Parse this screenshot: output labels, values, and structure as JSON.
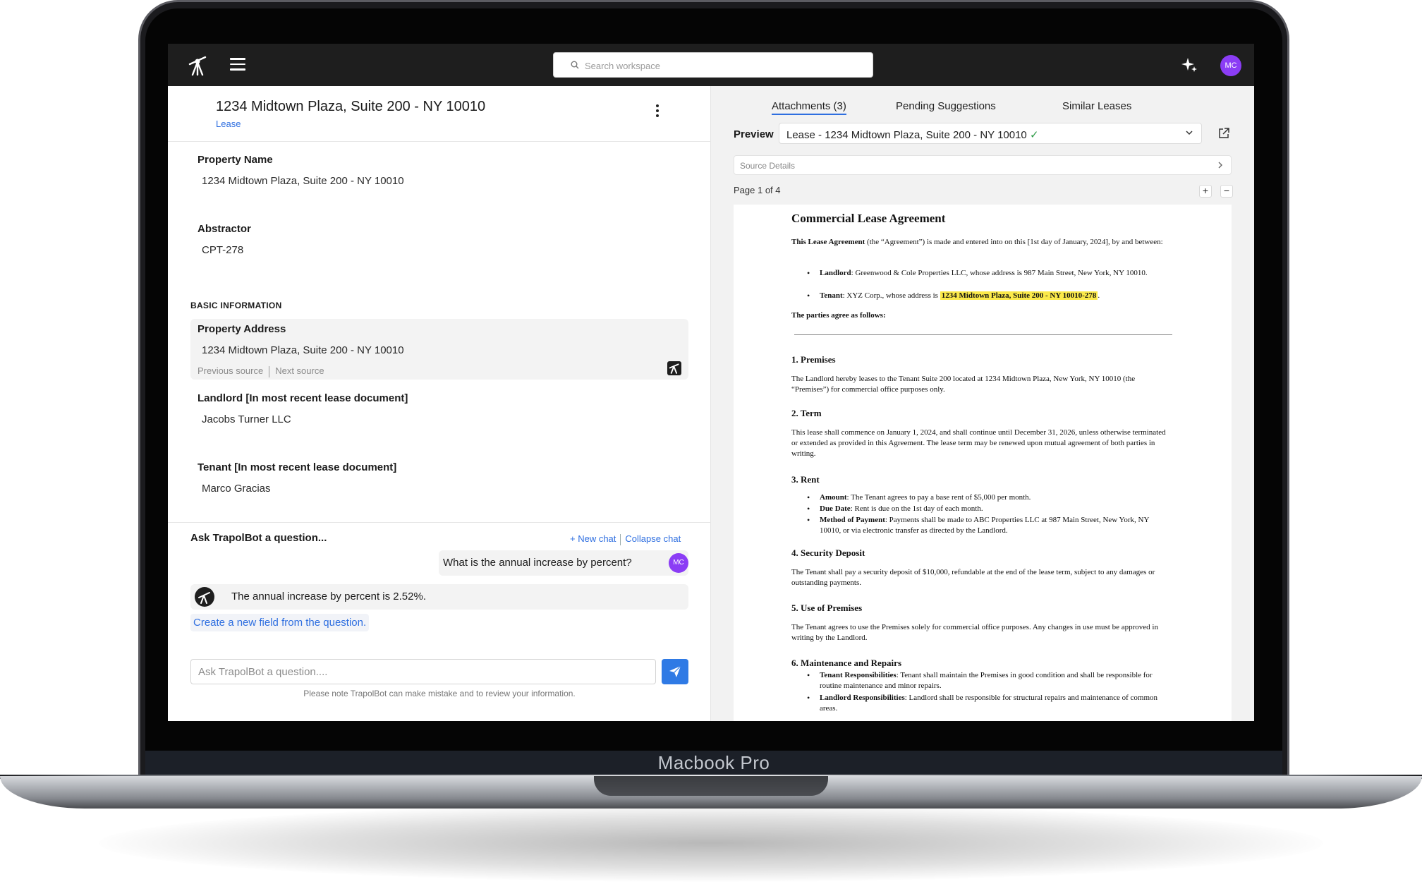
{
  "device": {
    "label": "Macbook Pro"
  },
  "topbar": {
    "search_placeholder": "Search workspace",
    "avatar_initials": "MC"
  },
  "record": {
    "title": "1234 Midtown Plaza, Suite 200 - NY 10010",
    "type": "Lease"
  },
  "fields": {
    "property_name": {
      "label": "Property Name",
      "value": "1234 Midtown Plaza, Suite 200 - NY 10010"
    },
    "abstractor": {
      "label": "Abstractor",
      "value": "CPT-278"
    },
    "section_title": "BASIC INFORMATION",
    "property_address": {
      "label": "Property Address",
      "value": "1234 Midtown Plaza, Suite 200 - NY 10010"
    },
    "source_nav": {
      "previous": "Previous source",
      "next": "Next source"
    },
    "landlord": {
      "label": "Landlord [In most recent lease document]",
      "value": "Jacobs Turner LLC"
    },
    "tenant": {
      "label": "Tenant [In most recent lease document]",
      "value": "Marco Gracias"
    }
  },
  "chat": {
    "heading": "Ask TrapolBot a question...",
    "new_chat": "+ New chat",
    "collapse_chat": "Collapse chat",
    "user_message": "What is the annual increase by percent?",
    "user_initials": "MC",
    "bot_message": "The annual increase by percent is 2.52%.",
    "create_field": "Create a new field from the question.",
    "input_placeholder": "Ask TrapolBot a question....",
    "disclaimer": "Please note TrapolBot can make mistake and to review your information."
  },
  "right": {
    "tabs": [
      "Attachments (3)",
      "Pending Suggestions",
      "Similar Leases"
    ],
    "preview_label": "Preview",
    "selected_document": "Lease - 1234 Midtown Plaza, Suite 200 - NY 10010",
    "source_details": "Source Details",
    "page_indicator": "Page 1 of 4",
    "zoom_in": "+",
    "zoom_out": "−"
  },
  "document": {
    "title": "Commercial Lease Agreement",
    "intro_bold": "This Lease Agreement",
    "intro_rest": " (the “Agreement”) is made and entered into on this [1st day of January, 2024], by and between:",
    "landlord_label": "Landlord",
    "landlord_text": ": Greenwood & Cole Properties LLC, whose address is 987 Main Street, New York, NY 10010.",
    "tenant_label": "Tenant",
    "tenant_text": ": XYZ Corp., whose address is ",
    "tenant_highlight": "1234 Midtown Plaza, Suite 200 - NY 10010-278",
    "tenant_end": ".",
    "parties": "The parties agree as follows:",
    "s1_title": "1. Premises",
    "s1_text": "The Landlord hereby leases to the Tenant Suite 200 located at 1234 Midtown Plaza, New York, NY 10010 (the “Premises”) for commercial office purposes only.",
    "s2_title": "2. Term",
    "s2_text": "This lease shall commence on January 1, 2024, and shall continue until December 31, 2026, unless otherwise terminated or extended as provided in this Agreement. The lease term may be renewed upon mutual agreement of both parties in writing.",
    "s3_title": "3. Rent",
    "s3_amount_label": "Amount",
    "s3_amount": ": The Tenant agrees to pay a base rent of $5,000 per month.",
    "s3_due_label": "Due Date",
    "s3_due": ": Rent is due on the 1st day of each month.",
    "s3_method_label": "Method of Payment",
    "s3_method": ": Payments shall be made to ABC Properties LLC at 987 Main Street, New York, NY 10010, or via electronic transfer as directed by the Landlord.",
    "s4_title": "4. Security Deposit",
    "s4_text": "The Tenant shall pay a security deposit of $10,000, refundable at the end of the lease term, subject to any damages or outstanding payments.",
    "s5_title": "5. Use of Premises",
    "s5_text": "The Tenant agrees to use the Premises solely for commercial office purposes. Any changes in use must be approved in writing by the Landlord.",
    "s6_title": "6. Maintenance and Repairs",
    "s6_tenant_label": "Tenant Responsibilities",
    "s6_tenant": ": Tenant shall maintain the Premises in good condition and shall be responsible for routine maintenance and minor repairs.",
    "s6_landlord_label": "Landlord Responsibilities",
    "s6_landlord": ": Landlord shall be responsible for structural repairs and maintenance of common areas."
  }
}
